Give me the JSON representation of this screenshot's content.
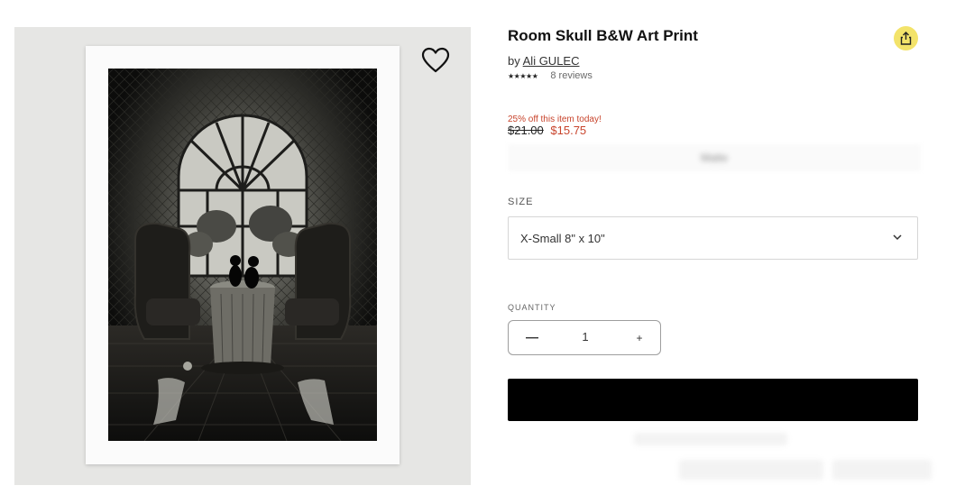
{
  "product": {
    "title": "Room Skull B&W Art Print",
    "by_label": "by",
    "artist": "Ali GULEC",
    "stars": "★★★★★",
    "reviews": "8 reviews"
  },
  "pricing": {
    "promo": "25% off this item today!",
    "old_price": "$21.00",
    "new_price": "$15.75"
  },
  "blurred_option": "Matte",
  "size": {
    "label": "SIZE",
    "selected": "X-Small 8\" x 10\""
  },
  "quantity": {
    "label": "QUANTITY",
    "value": "1",
    "plus": "+"
  },
  "colors": {
    "accent_sale": "#c8442c",
    "share_bg": "#f3e36a",
    "button_bg": "#000000"
  },
  "icons": {
    "favorite": "heart-icon",
    "share": "share-icon",
    "dropdown": "chevron-down-icon",
    "decrease": "minus-icon"
  }
}
